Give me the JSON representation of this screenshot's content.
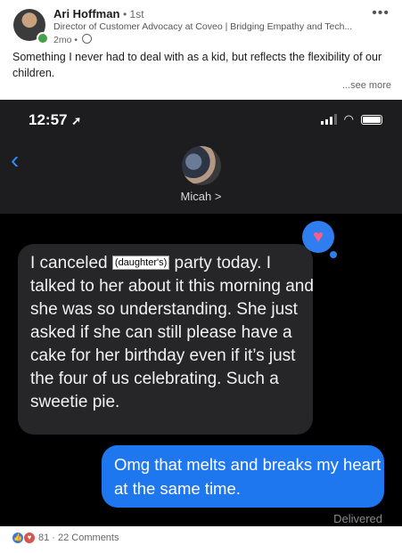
{
  "post": {
    "author": "Ari Hoffman",
    "degree": "• 1st",
    "headline": "Director of Customer Advocacy at Coveo | Bridging Empathy and Tech...",
    "time": "2mo •",
    "more_icon": "•••",
    "text": "Something I never had to deal with as a kid, but reflects the flexibility of our children.",
    "see_more": "...see more"
  },
  "screenshot": {
    "time": "12:57",
    "contact_name": "Micah >",
    "incoming_before": "I canceled",
    "incoming_tag": "(daughter's)",
    "incoming_after": "party today. I talked to her about it this morning and she was so understanding. She just asked if she can still please have a cake for her birthday even if it’s just the four of us celebrating. Such a sweetie pie.",
    "outgoing": "Omg that melts and breaks my heart at the same time.",
    "delivered": "Delivered"
  },
  "social": {
    "counts": "81 · 22 Comments"
  },
  "colors": {
    "imessage_blue": "#1f77f0",
    "incoming_bubble": "#262628",
    "ios_link_blue": "#2f8cff"
  }
}
